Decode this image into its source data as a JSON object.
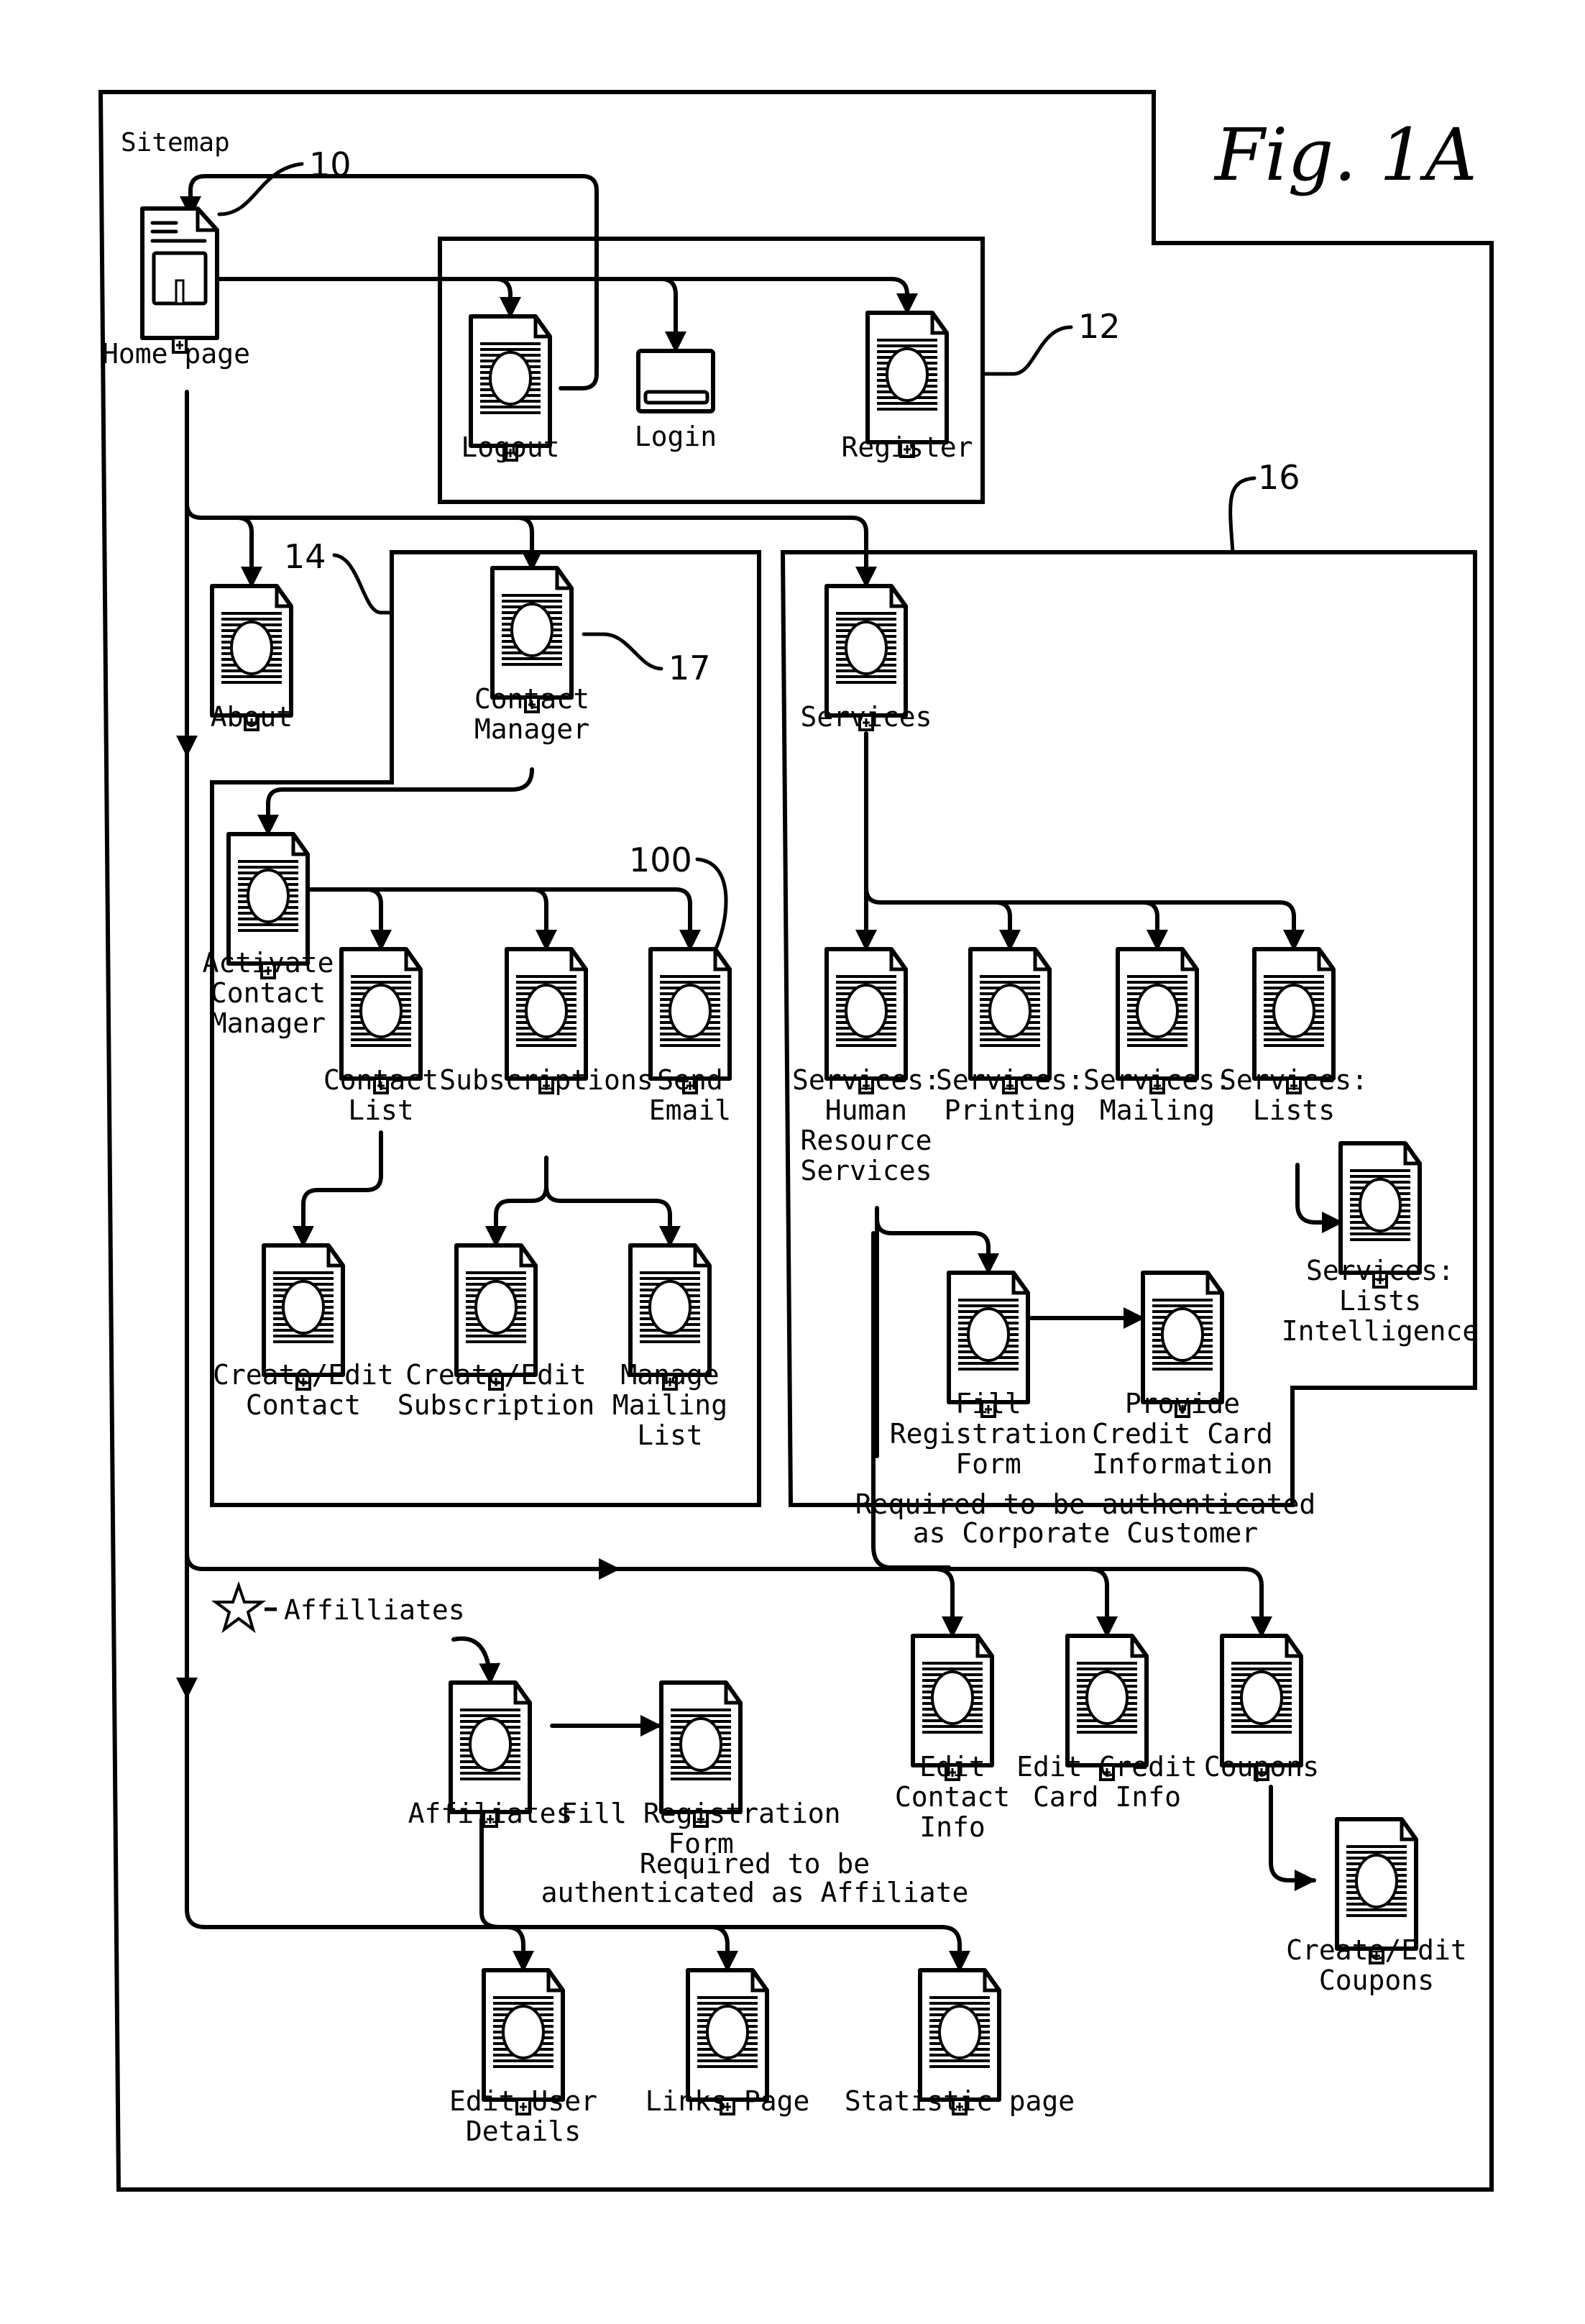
{
  "figure": {
    "title": "Fig. 1A",
    "sitemap_label": "Sitemap"
  },
  "reference_numerals": {
    "home": "10",
    "auth_group": "12",
    "contact_group": "14",
    "services_group": "16",
    "contact_manager": "17",
    "send_email": "100"
  },
  "nodes": {
    "home": {
      "label": [
        "Home page"
      ],
      "icon": "home-page-icon"
    },
    "logout": {
      "label": [
        "Logout"
      ],
      "icon": "page-icon"
    },
    "login": {
      "label": [
        "Login"
      ],
      "icon": "login-form-icon"
    },
    "register": {
      "label": [
        "Register"
      ],
      "icon": "page-icon"
    },
    "about": {
      "label": [
        "About"
      ],
      "icon": "page-icon"
    },
    "contact_manager": {
      "label": [
        "Contact",
        "Manager"
      ],
      "icon": "page-icon"
    },
    "activate_cm": {
      "label": [
        "Activate",
        "Contact",
        "Manager"
      ],
      "icon": "page-icon"
    },
    "contact_list": {
      "label": [
        "Contact",
        "List"
      ],
      "icon": "page-icon"
    },
    "subscriptions": {
      "label": [
        "Subscriptions"
      ],
      "icon": "page-icon"
    },
    "send_email": {
      "label": [
        "Send",
        "Email"
      ],
      "icon": "page-icon"
    },
    "ce_contact": {
      "label": [
        "Create/Edit",
        "Contact"
      ],
      "icon": "page-icon"
    },
    "ce_subscription": {
      "label": [
        "Create/Edit",
        "Subscription"
      ],
      "icon": "page-icon"
    },
    "manage_ml": {
      "label": [
        "Manage",
        "Mailing",
        "List"
      ],
      "icon": "page-icon"
    },
    "services": {
      "label": [
        "Services"
      ],
      "icon": "page-icon"
    },
    "svc_hr": {
      "label": [
        "Services:",
        "Human",
        "Resource",
        "Services"
      ],
      "icon": "page-icon"
    },
    "svc_printing": {
      "label": [
        "Services:",
        "Printing"
      ],
      "icon": "page-icon"
    },
    "svc_mailing": {
      "label": [
        "Services:",
        "Mailing"
      ],
      "icon": "page-icon"
    },
    "svc_lists": {
      "label": [
        "Services:",
        "Lists"
      ],
      "icon": "page-icon"
    },
    "svc_lists_intel": {
      "label": [
        "Services:",
        "Lists",
        "Intelligence"
      ],
      "icon": "page-icon"
    },
    "fill_reg_svc": {
      "label": [
        "Fill",
        "Registration",
        "Form"
      ],
      "icon": "page-icon"
    },
    "credit_card": {
      "label": [
        "Provide",
        "Credit Card",
        "Information"
      ],
      "icon": "page-icon"
    },
    "edit_contact_info": {
      "label": [
        "Edit",
        "Contact",
        "Info"
      ],
      "icon": "page-icon"
    },
    "edit_cc_info": {
      "label": [
        "Edit Credit",
        "Card Info"
      ],
      "icon": "page-icon"
    },
    "coupons": {
      "label": [
        "Coupons"
      ],
      "icon": "page-icon"
    },
    "ce_coupons": {
      "label": [
        "Create/Edit",
        "Coupons"
      ],
      "icon": "page-icon"
    },
    "affiliates": {
      "label": [
        "Affiliates"
      ],
      "icon": "page-icon"
    },
    "fill_reg_aff": {
      "label": [
        "Fill Registration",
        "Form"
      ],
      "icon": "page-icon"
    },
    "edit_user": {
      "label": [
        "Edit User",
        "Details"
      ],
      "icon": "page-icon"
    },
    "links_page": {
      "label": [
        "Links Page"
      ],
      "icon": "page-icon"
    },
    "statistic_page": {
      "label": [
        "Statistic page"
      ],
      "icon": "page-icon"
    }
  },
  "annotations": {
    "corporate": [
      "Required to be authenticated",
      "as Corporate Customer"
    ],
    "affiliate": [
      "Required to be",
      "authenticated as Affiliate"
    ],
    "affiliates_marker": "Affilliates"
  }
}
